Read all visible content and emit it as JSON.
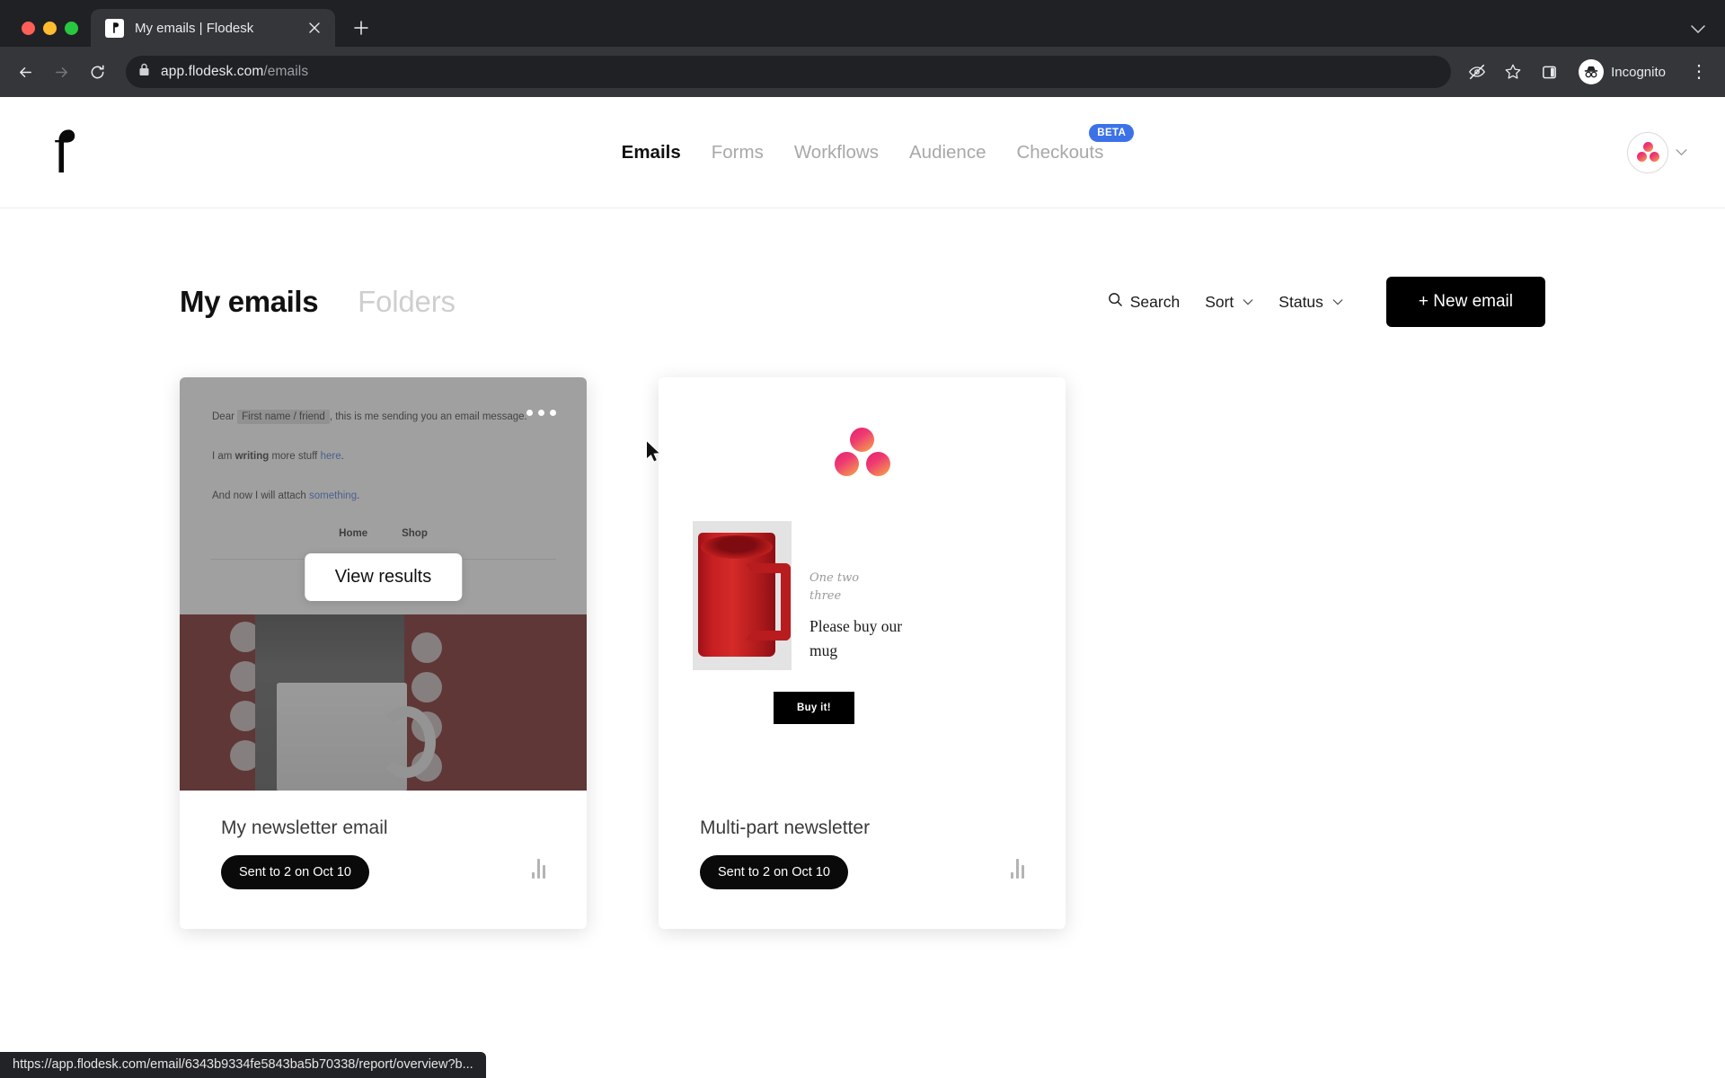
{
  "browser": {
    "tab": {
      "title": "My emails | Flodesk",
      "favicon_icon": "flodesk-favicon",
      "close_icon": "close-icon"
    },
    "new_tab_icon": "plus-icon",
    "tabstrip_chevron_icon": "chevron-down-icon",
    "back_icon": "back-arrow-icon",
    "forward_icon": "forward-arrow-icon",
    "reload_icon": "reload-icon",
    "lock_icon": "lock-icon",
    "url_host": "app.flodesk.com",
    "url_path": "/emails",
    "toolbar_icons": [
      "eye-slash-icon",
      "star-icon",
      "side-panel-icon"
    ],
    "incognito_label": "Incognito",
    "incognito_icon": "incognito-icon",
    "menu_icon": "kebab-menu-icon",
    "status_url": "https://app.flodesk.com/email/6343b9334fe5843ba5b70338/report/overview?b..."
  },
  "appnav": {
    "brand_icon": "flodesk-logo",
    "links": [
      {
        "label": "Emails",
        "active": true
      },
      {
        "label": "Forms",
        "active": false
      },
      {
        "label": "Workflows",
        "active": false
      },
      {
        "label": "Audience",
        "active": false
      },
      {
        "label": "Checkouts",
        "active": false,
        "badge": "BETA"
      }
    ],
    "account": {
      "avatar_icon": "flodesk-avatar",
      "chevron_icon": "chevron-down-icon"
    }
  },
  "page": {
    "title": "My emails",
    "folders_tab": "Folders",
    "tools": {
      "search_label": "Search",
      "search_icon": "search-icon",
      "sort_label": "Sort",
      "status_label": "Status",
      "chevron_icon": "chevron-down-icon",
      "new_email_label": "+ New email"
    }
  },
  "cards": [
    {
      "name": "My newsletter email",
      "sent_label": "Sent to 2 on Oct 10",
      "hovered": true,
      "overlay_button": "View results",
      "menu_icon": "more-options-icon",
      "stats_icon": "bar-chart-icon",
      "preview": {
        "greeting_prefix": "Dear",
        "merge_tag": "First name / friend",
        "greeting_suffix": ", this is me sending you an email message.",
        "line2_before": "I am ",
        "line2_bold": "writing",
        "line2_mid": " more stuff ",
        "line2_link": "here",
        "line2_end": ".",
        "line3_before": "And now I will attach ",
        "line3_link": "something",
        "line3_end": ".",
        "nav": [
          "Home",
          "Shop"
        ]
      }
    },
    {
      "name": "Multi-part newsletter",
      "sent_label": "Sent to 2 on Oct 10",
      "hovered": false,
      "stats_icon": "bar-chart-icon",
      "preview": {
        "logo_icon": "flodesk-dots-logo",
        "script_line1": "One  two",
        "script_line2": "three",
        "headline_line1": "Please buy our",
        "headline_line2": "mug",
        "cta_label": "Buy it!",
        "product_image": "red-mug-photo"
      }
    }
  ],
  "colors": {
    "accent_pink": "#e8266e",
    "accent_orange": "#f6a04a",
    "beta_blue": "#3b72e8",
    "button_black": "#000000",
    "mug_red": "#c61f22",
    "preview_banner_red": "#6b1010"
  }
}
